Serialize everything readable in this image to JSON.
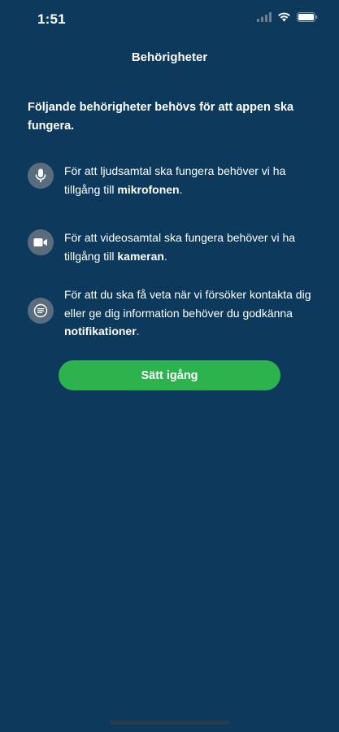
{
  "status_bar": {
    "time": "1:51",
    "icons": [
      "signal-icon",
      "wifi-icon",
      "battery-icon"
    ]
  },
  "header": {
    "title": "Behörigheter"
  },
  "intro": "Följande behörigheter behövs för att appen ska fungera.",
  "permissions": [
    {
      "icon": "microphone-icon",
      "text": "För att ljudsamtal ska fungera behöver vi ha tillgång till ",
      "bold": "mikrofonen",
      "suffix": "."
    },
    {
      "icon": "video-camera-icon",
      "text": "För att videosamtal ska fungera behöver vi ha tillgång till ",
      "bold": "kameran",
      "suffix": "."
    },
    {
      "icon": "notification-icon",
      "text": "För att du ska få veta när vi försöker kontakta dig eller ge dig information behöver du godkänna ",
      "bold": "notifikationer",
      "suffix": "."
    }
  ],
  "start_button": {
    "label": "Sätt igång"
  },
  "colors": {
    "background": "#0d3a5c",
    "accent": "#2db34e",
    "icon_circle": "#5b6d7c"
  }
}
